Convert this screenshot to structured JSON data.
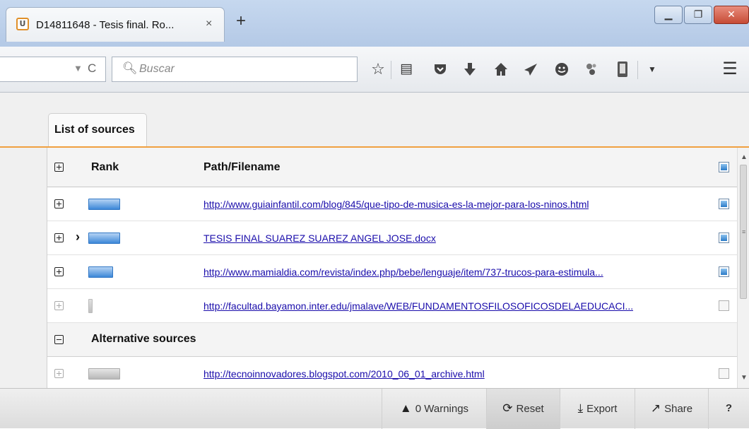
{
  "browser": {
    "tab_title": "D14811648 - Tesis final. Ro...",
    "tab_close": "×",
    "new_tab": "+",
    "window_min": "▁",
    "window_max": "❐",
    "window_close": "✕",
    "url_dropdown": "▼",
    "reload": "C",
    "search_placeholder": "Buscar",
    "toolbar_icons": [
      "star-icon",
      "reading-list-icon",
      "pocket-icon",
      "download-icon",
      "home-icon",
      "send-icon",
      "chat-icon",
      "extension-icon",
      "device-icon",
      "overflow-icon",
      "menu-icon"
    ]
  },
  "panel": {
    "tab_label": "List of sources",
    "columns": {
      "rank": "Rank",
      "path": "Path/Filename"
    },
    "sources": [
      {
        "rank_fill": 0.9,
        "active": true,
        "selected": false,
        "path": "http://www.guiainfantil.com/blog/845/que-tipo-de-musica-es-la-mejor-para-los-ninos.html",
        "checked": true
      },
      {
        "rank_fill": 0.9,
        "active": true,
        "selected": true,
        "path": "TESIS FINAL SUAREZ SUAREZ ANGEL JOSE.docx",
        "checked": true
      },
      {
        "rank_fill": 0.7,
        "active": true,
        "selected": false,
        "path": "http://www.mamialdia.com/revista/index.php/bebe/lenguaje/item/737-trucos-para-estimula...",
        "checked": true
      },
      {
        "rank_fill": 0.1,
        "active": false,
        "selected": false,
        "path": "http://facultad.bayamon.inter.edu/jmalave/WEB/FUNDAMENTOSFILOSOFICOSDELAEDUCACI...",
        "checked": false
      }
    ],
    "alternative_label": "Alternative sources",
    "alternative": [
      {
        "rank_fill": 0.9,
        "active": false,
        "path": "http://tecnoinnovadores.blogspot.com/2010_06_01_archive.html",
        "checked": false
      }
    ]
  },
  "footer": {
    "warnings": "0 Warnings",
    "reset": "Reset",
    "export": "Export",
    "share": "Share",
    "help": "?"
  },
  "colors": {
    "accent": "#f0a040",
    "rank_blue": "#3d88d8",
    "link": "#1a0dab"
  }
}
